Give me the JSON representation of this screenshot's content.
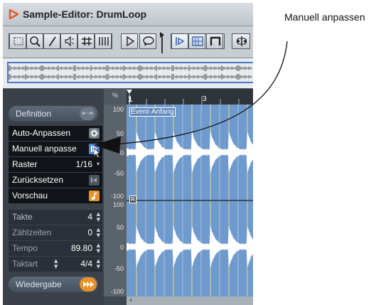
{
  "window": {
    "title": "Sample-Editor: DrumLoop",
    "accent": "#e8532a"
  },
  "toolbar": {
    "tools": [
      "range-select-icon",
      "zoom-icon",
      "pencil-icon",
      "speaker-icon",
      "scrub-icon",
      "hitpoint-icon",
      "play-icon",
      "loop-play-icon",
      "snap-to-zero-icon",
      "audition-icon",
      "grid-icon",
      "bars-icon"
    ]
  },
  "ruler": {
    "percent_label": "%",
    "marks": [
      "1",
      "3"
    ]
  },
  "waveform": {
    "event_start_label": "Event-Anfang",
    "marker_label": "R",
    "fill_color": "#6f9acd",
    "scale_top": [
      "100",
      "50",
      "0",
      "-50",
      "-100"
    ],
    "scale_bottom": [
      "100",
      "50",
      "0",
      "-50",
      "-100"
    ]
  },
  "panel": {
    "definition": "Definition",
    "auto_adjust": "Auto-Anpassen",
    "manual_adjust": "Manuell anpasse",
    "grid_label": "Raster",
    "grid_value": "1/16",
    "reset_label": "Zurücksetzen",
    "preview_label": "Vorschau",
    "bars_label": "Takte",
    "bars_value": "4",
    "beats_label": "Zählzeiten",
    "beats_value": "0",
    "tempo_label": "Tempo",
    "tempo_value": "89.80",
    "signature_label": "Taktart",
    "signature_value": "4/4",
    "playback": "Wiedergabe"
  },
  "annotation": {
    "text": "Manuell anpassen"
  }
}
